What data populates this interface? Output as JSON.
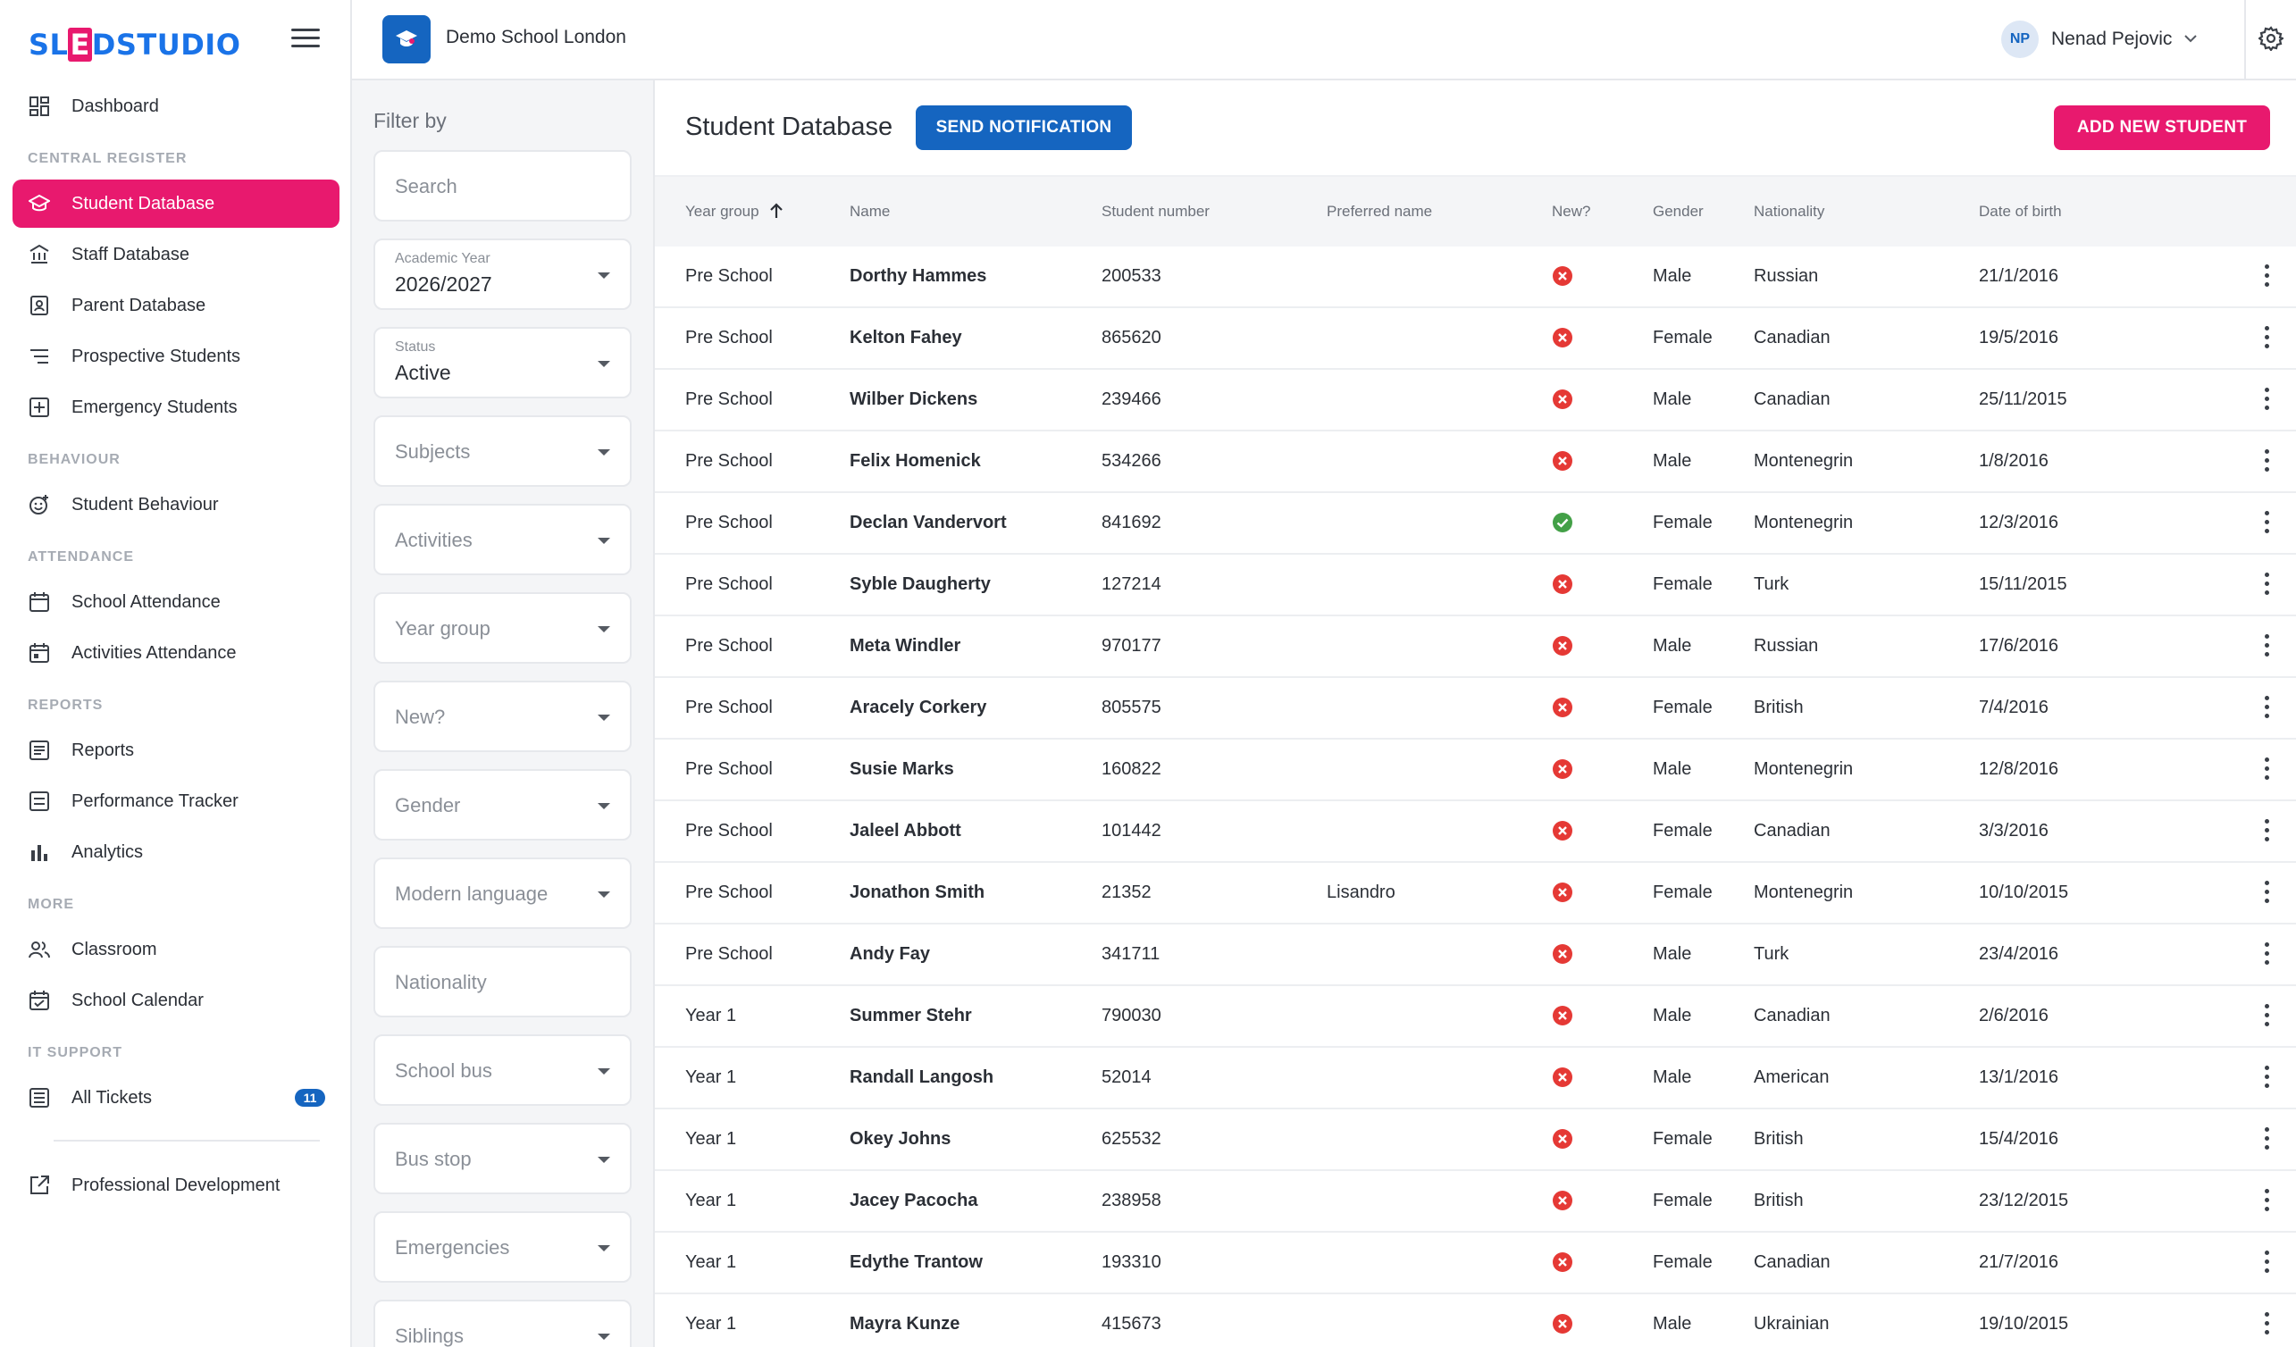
{
  "app": {
    "logo": {
      "part1": "SL",
      "part2": "E",
      "part3": "D",
      "part4": "STUDIO"
    },
    "school_name": "Demo School London",
    "user": {
      "initials": "NP",
      "name": "Nenad Pejovic"
    }
  },
  "sidebar": {
    "dashboard": "Dashboard",
    "sections": {
      "central": "CENTRAL REGISTER",
      "behaviour": "BEHAVIOUR",
      "attendance": "ATTENDANCE",
      "reports": "REPORTS",
      "more": "MORE",
      "it": "IT SUPPORT"
    },
    "items": {
      "student_db": "Student Database",
      "staff_db": "Staff Database",
      "parent_db": "Parent Database",
      "prospective": "Prospective Students",
      "emergency": "Emergency Students",
      "behaviour": "Student Behaviour",
      "school_att": "School Attendance",
      "activities_att": "Activities Attendance",
      "reports": "Reports",
      "performance": "Performance Tracker",
      "analytics": "Analytics",
      "classroom": "Classroom",
      "calendar": "School Calendar",
      "tickets": "All Tickets",
      "tickets_count": "11",
      "prof_dev": "Professional Development"
    }
  },
  "filters": {
    "title": "Filter by",
    "search_placeholder": "Search",
    "academic_year": {
      "label": "Academic Year",
      "value": "2026/2027"
    },
    "status": {
      "label": "Status",
      "value": "Active"
    },
    "subjects": "Subjects",
    "activities": "Activities",
    "year_group": "Year group",
    "new": "New?",
    "gender": "Gender",
    "modern_language": "Modern language",
    "nationality": "Nationality",
    "school_bus": "School bus",
    "bus_stop": "Bus stop",
    "emergencies": "Emergencies",
    "siblings": "Siblings"
  },
  "main": {
    "title": "Student Database",
    "send_notification": "SEND NOTIFICATION",
    "add_student": "ADD NEW STUDENT",
    "columns": {
      "year": "Year group",
      "name": "Name",
      "number": "Student number",
      "preferred": "Preferred name",
      "new": "New?",
      "gender": "Gender",
      "nationality": "Nationality",
      "dob": "Date of birth"
    },
    "rows": [
      {
        "year": "Pre School",
        "name": "Dorthy Hammes",
        "number": "200533",
        "preferred": "",
        "new": false,
        "gender": "Male",
        "nationality": "Russian",
        "dob": "21/1/2016"
      },
      {
        "year": "Pre School",
        "name": "Kelton Fahey",
        "number": "865620",
        "preferred": "",
        "new": false,
        "gender": "Female",
        "nationality": "Canadian",
        "dob": "19/5/2016"
      },
      {
        "year": "Pre School",
        "name": "Wilber Dickens",
        "number": "239466",
        "preferred": "",
        "new": false,
        "gender": "Male",
        "nationality": "Canadian",
        "dob": "25/11/2015"
      },
      {
        "year": "Pre School",
        "name": "Felix Homenick",
        "number": "534266",
        "preferred": "",
        "new": false,
        "gender": "Male",
        "nationality": "Montenegrin",
        "dob": "1/8/2016"
      },
      {
        "year": "Pre School",
        "name": "Declan Vandervort",
        "number": "841692",
        "preferred": "",
        "new": true,
        "gender": "Female",
        "nationality": "Montenegrin",
        "dob": "12/3/2016"
      },
      {
        "year": "Pre School",
        "name": "Syble Daugherty",
        "number": "127214",
        "preferred": "",
        "new": false,
        "gender": "Female",
        "nationality": "Turk",
        "dob": "15/11/2015"
      },
      {
        "year": "Pre School",
        "name": "Meta Windler",
        "number": "970177",
        "preferred": "",
        "new": false,
        "gender": "Male",
        "nationality": "Russian",
        "dob": "17/6/2016"
      },
      {
        "year": "Pre School",
        "name": "Aracely Corkery",
        "number": "805575",
        "preferred": "",
        "new": false,
        "gender": "Female",
        "nationality": "British",
        "dob": "7/4/2016"
      },
      {
        "year": "Pre School",
        "name": "Susie Marks",
        "number": "160822",
        "preferred": "",
        "new": false,
        "gender": "Male",
        "nationality": "Montenegrin",
        "dob": "12/8/2016"
      },
      {
        "year": "Pre School",
        "name": "Jaleel Abbott",
        "number": "101442",
        "preferred": "",
        "new": false,
        "gender": "Female",
        "nationality": "Canadian",
        "dob": "3/3/2016"
      },
      {
        "year": "Pre School",
        "name": "Jonathon Smith",
        "number": "21352",
        "preferred": "Lisandro",
        "new": false,
        "gender": "Female",
        "nationality": "Montenegrin",
        "dob": "10/10/2015"
      },
      {
        "year": "Pre School",
        "name": "Andy Fay",
        "number": "341711",
        "preferred": "",
        "new": false,
        "gender": "Male",
        "nationality": "Turk",
        "dob": "23/4/2016"
      },
      {
        "year": "Year 1",
        "name": "Summer Stehr",
        "number": "790030",
        "preferred": "",
        "new": false,
        "gender": "Male",
        "nationality": "Canadian",
        "dob": "2/6/2016"
      },
      {
        "year": "Year 1",
        "name": "Randall Langosh",
        "number": "52014",
        "preferred": "",
        "new": false,
        "gender": "Male",
        "nationality": "American",
        "dob": "13/1/2016"
      },
      {
        "year": "Year 1",
        "name": "Okey Johns",
        "number": "625532",
        "preferred": "",
        "new": false,
        "gender": "Female",
        "nationality": "British",
        "dob": "15/4/2016"
      },
      {
        "year": "Year 1",
        "name": "Jacey Pacocha",
        "number": "238958",
        "preferred": "",
        "new": false,
        "gender": "Female",
        "nationality": "British",
        "dob": "23/12/2015"
      },
      {
        "year": "Year 1",
        "name": "Edythe Trantow",
        "number": "193310",
        "preferred": "",
        "new": false,
        "gender": "Female",
        "nationality": "Canadian",
        "dob": "21/7/2016"
      },
      {
        "year": "Year 1",
        "name": "Mayra Kunze",
        "number": "415673",
        "preferred": "",
        "new": false,
        "gender": "Male",
        "nationality": "Ukrainian",
        "dob": "19/10/2015"
      }
    ]
  },
  "colors": {
    "primary": "#1565c0",
    "accent": "#e8196e",
    "no": "#e53935",
    "yes": "#43a047"
  }
}
